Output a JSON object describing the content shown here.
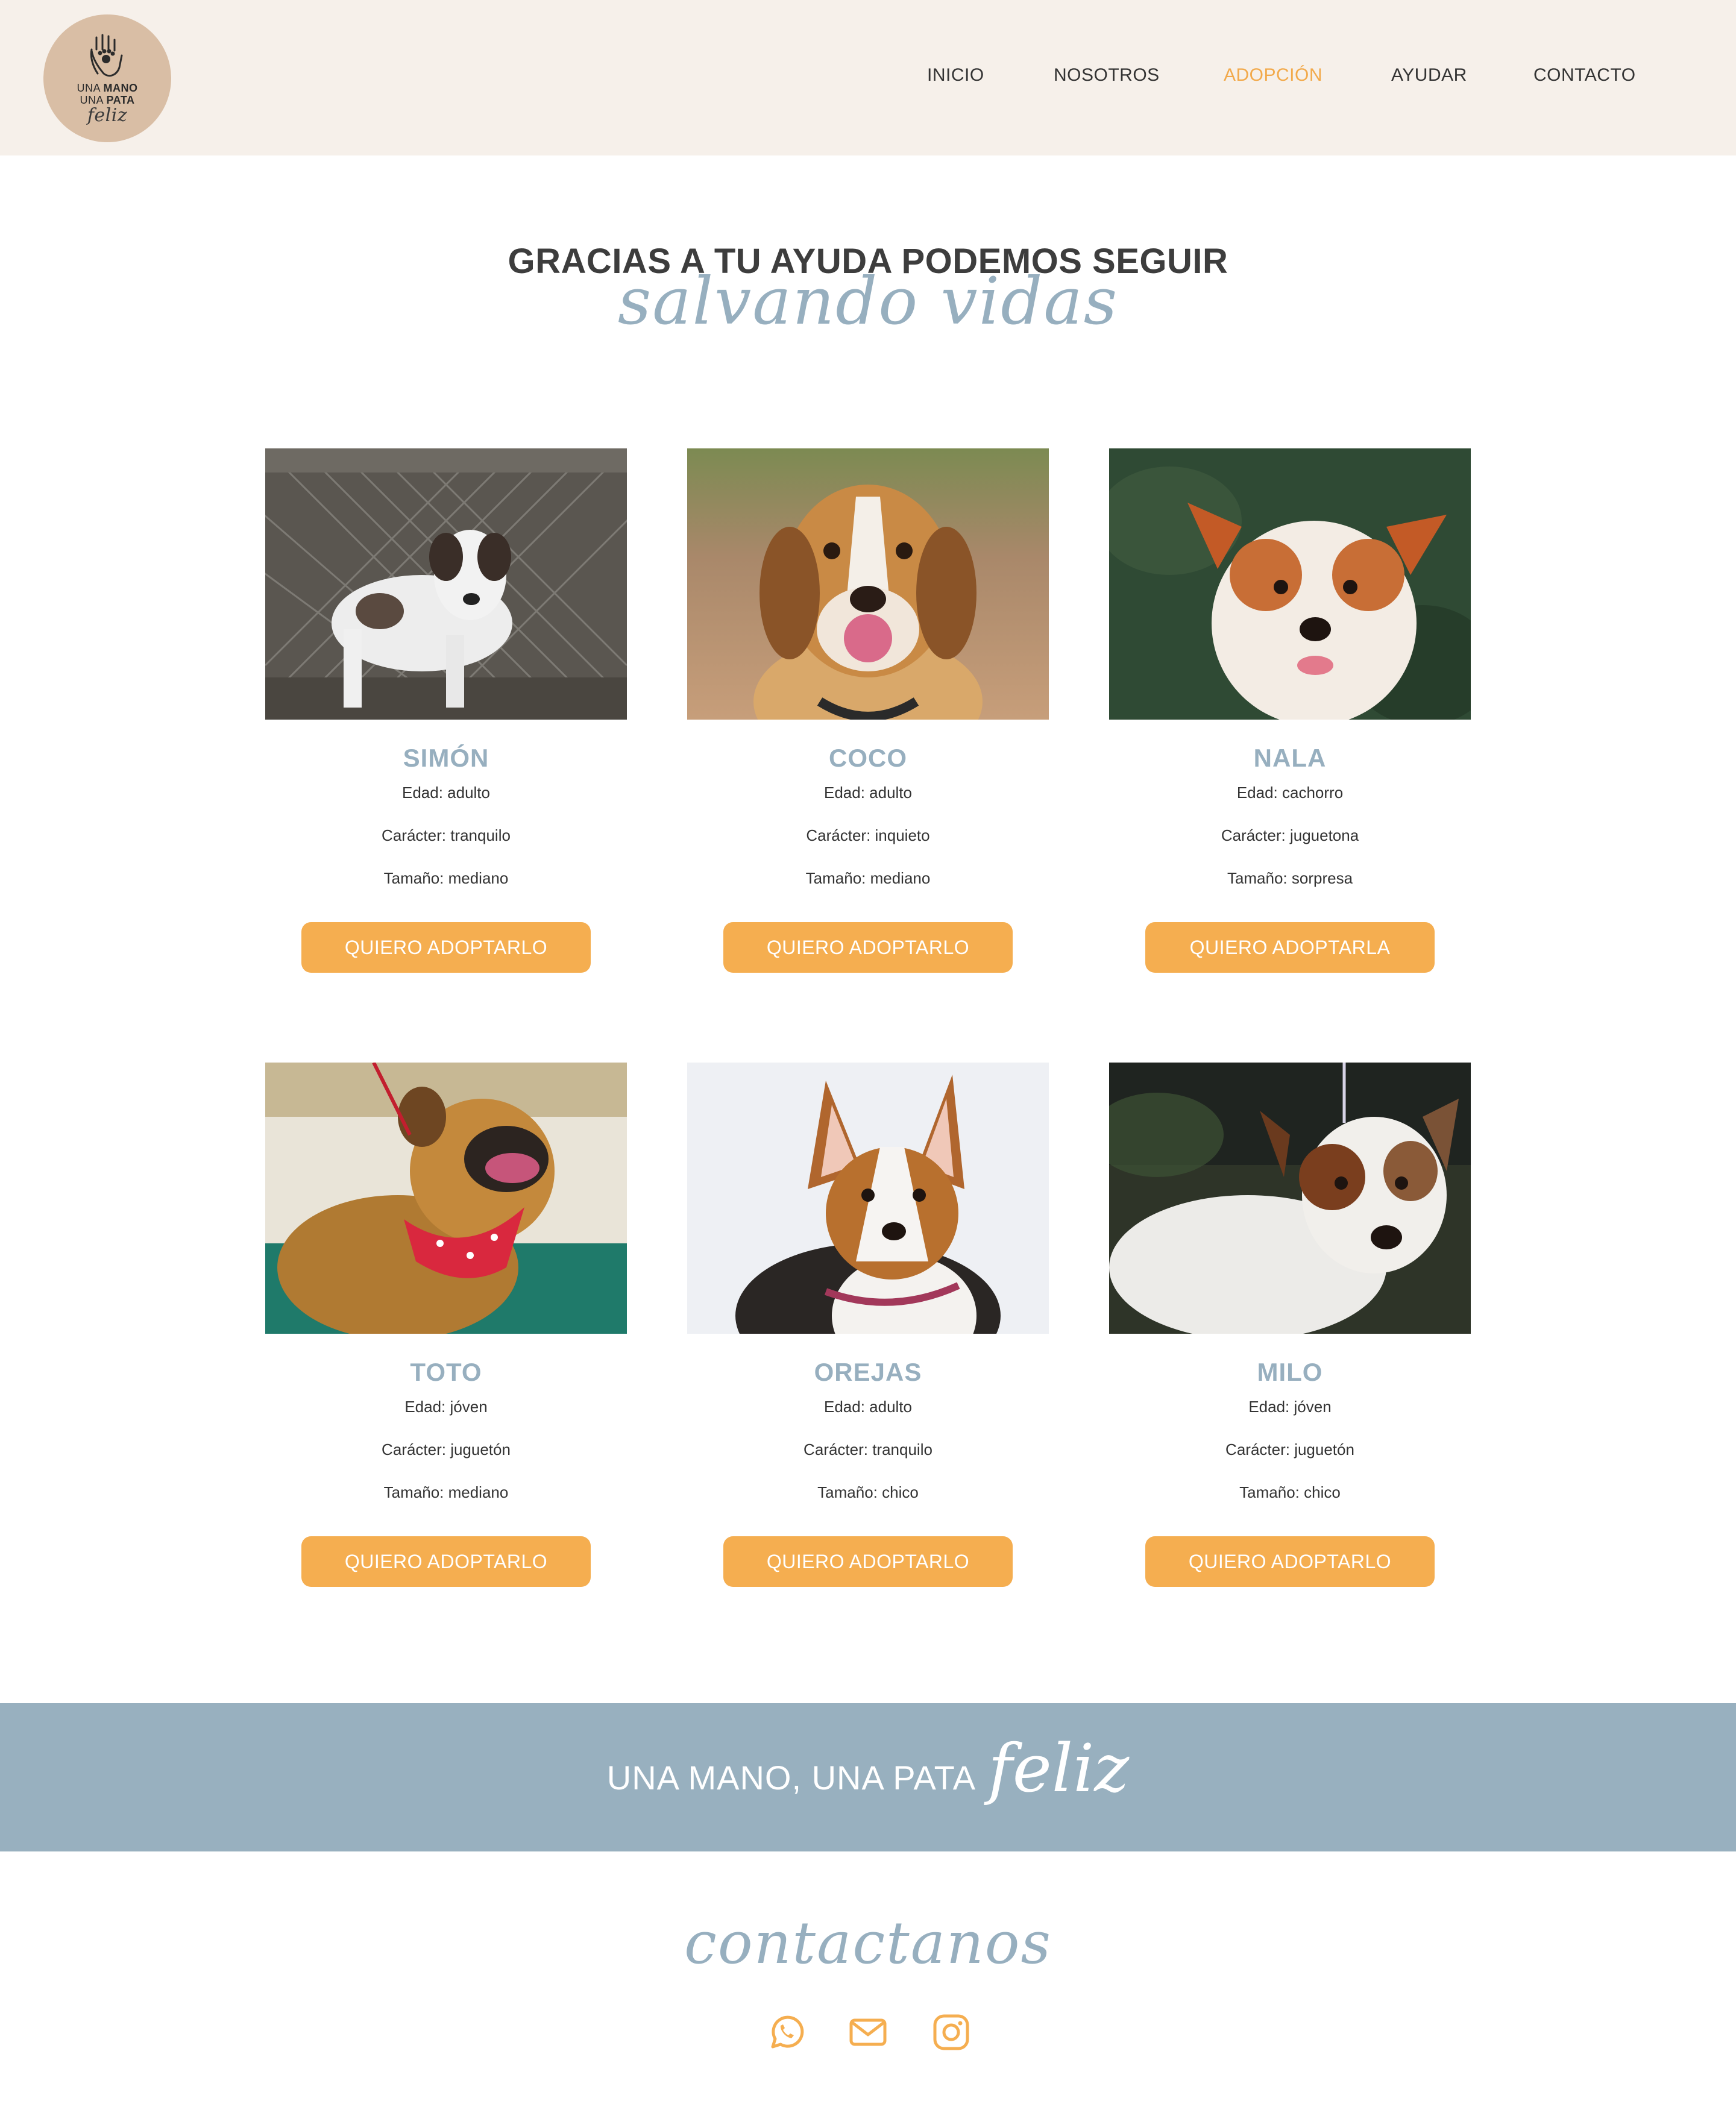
{
  "header": {
    "logo": {
      "line1_a": "UNA ",
      "line1_b": "MANO",
      "line2_a": "UNA ",
      "line2_b": "PATA",
      "line3": "feliz"
    },
    "nav": [
      "INICIO",
      "NOSOTROS",
      "ADOPCIÓN",
      "AYUDAR",
      "CONTACTO"
    ],
    "active_nav": "ADOPCIÓN"
  },
  "hero": {
    "title": "GRACIAS A TU AYUDA PODEMOS SEGUIR",
    "script": "salvando vidas"
  },
  "pets": [
    {
      "name": "SIMÓN",
      "edad": "Edad: adulto",
      "caracter": "Carácter: tranquilo",
      "tamano": "Tamaño: mediano",
      "button": "QUIERO ADOPTARLO"
    },
    {
      "name": "COCO",
      "edad": "Edad: adulto",
      "caracter": "Carácter: inquieto",
      "tamano": "Tamaño: mediano",
      "button": "QUIERO ADOPTARLO"
    },
    {
      "name": "NALA",
      "edad": "Edad: cachorro",
      "caracter": "Carácter: juguetona",
      "tamano": "Tamaño: sorpresa",
      "button": "QUIERO ADOPTARLA"
    },
    {
      "name": "TOTO",
      "edad": "Edad: jóven",
      "caracter": "Carácter: juguetón",
      "tamano": "Tamaño: mediano",
      "button": "QUIERO ADOPTARLO"
    },
    {
      "name": "OREJAS",
      "edad": "Edad: adulto",
      "caracter": "Carácter: tranquilo",
      "tamano": "Tamaño: chico",
      "button": "QUIERO ADOPTARLO"
    },
    {
      "name": "MILO",
      "edad": "Edad: jóven",
      "caracter": "Carácter: juguetón",
      "tamano": "Tamaño: chico",
      "button": "QUIERO ADOPTARLO"
    }
  ],
  "banner": {
    "text": "UNA MANO, UNA PATA",
    "script": "feliz"
  },
  "contact": {
    "title": "contactanos",
    "icons": [
      "whatsapp-icon",
      "email-icon",
      "instagram-icon"
    ]
  },
  "colors": {
    "header_bg": "#f6f0ea",
    "accent_orange": "#f5ae50",
    "accent_blue": "#97afbf",
    "logo_bg": "#d9bea5"
  }
}
